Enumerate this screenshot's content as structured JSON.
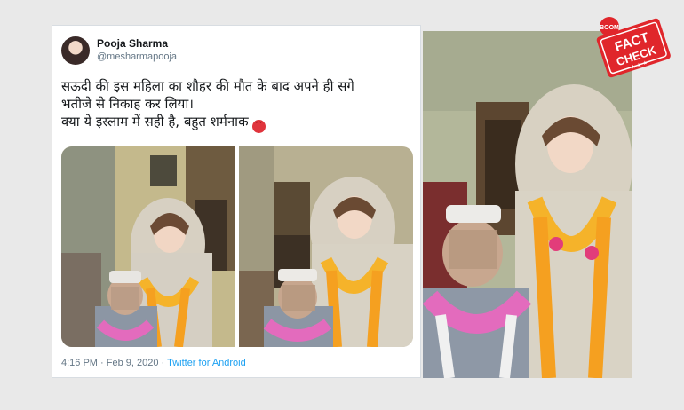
{
  "tweet": {
    "author_name": "Pooja Sharma",
    "author_handle": "@mesharmapooja",
    "text_lines": [
      "सऊदी की इस महिला का शौहर की मौत के बाद अपने ही सगे",
      "भतीजे से  निकाह कर लिया।",
      "क्या ये इस्लाम में सही है, बहुत शर्मनाक"
    ],
    "emoji": "angry-face",
    "time": "4:16 PM",
    "separator": "·",
    "date": "Feb 9, 2020",
    "source": "Twitter for Android"
  },
  "stamp": {
    "brand": "BOOM",
    "line1": "FACT",
    "line2": "CHECK",
    "color": "#e0262b"
  },
  "colors": {
    "background": "#e9e9e9",
    "card": "#ffffff",
    "link": "#1da1f2",
    "muted": "#657786"
  }
}
